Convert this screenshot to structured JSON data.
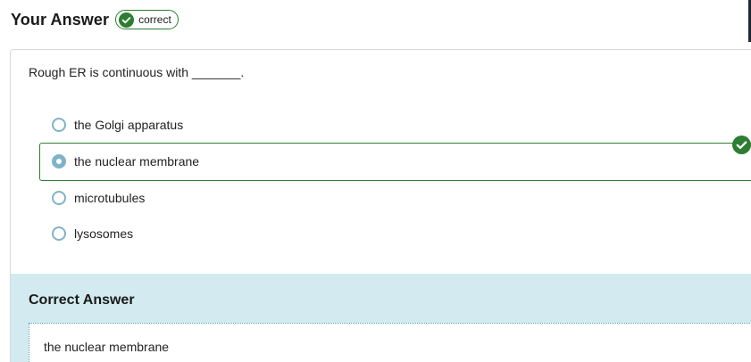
{
  "header": {
    "title": "Your Answer",
    "badge_label": "correct",
    "badge_icon": "check-circle-icon",
    "badge_color": "#2e7d32"
  },
  "question": {
    "text": "Rough ER is continuous with _______.",
    "options": [
      {
        "label": "the Golgi apparatus",
        "selected": false
      },
      {
        "label": "the nuclear membrane",
        "selected": true
      },
      {
        "label": "microtubules",
        "selected": false
      },
      {
        "label": "lysosomes",
        "selected": false
      }
    ],
    "selected_icon": "check-circle-icon"
  },
  "correct_answer": {
    "title": "Correct Answer",
    "value": "the nuclear membrane"
  },
  "colors": {
    "correct_green": "#2e7d32",
    "radio_blue": "#7fb3c8",
    "panel_bg": "#d3ebf0"
  }
}
